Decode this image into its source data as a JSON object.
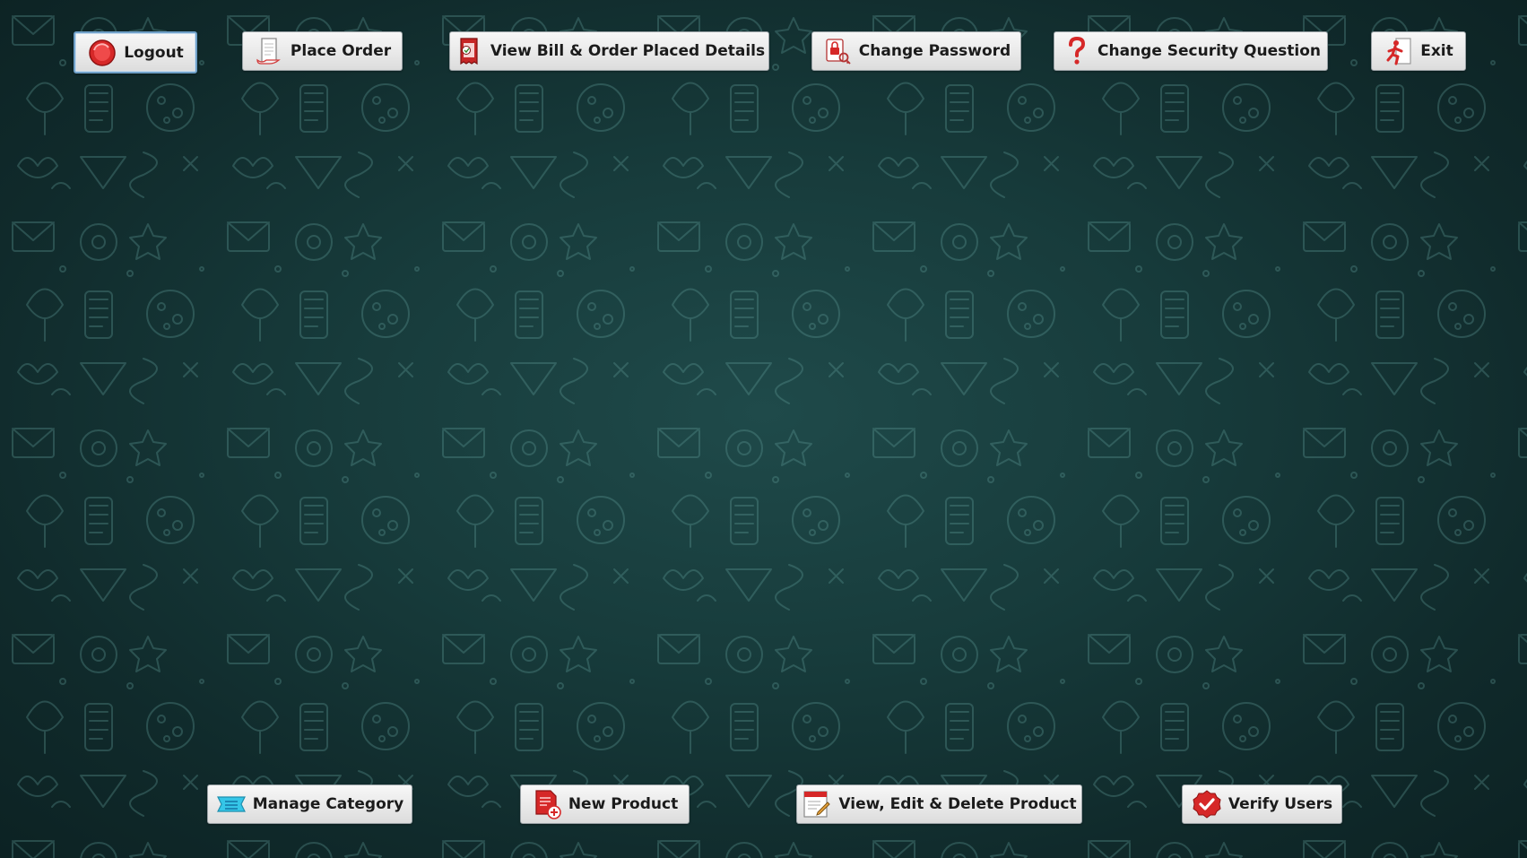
{
  "top_bar": {
    "logout_label": "Logout",
    "place_order_label": "Place Order",
    "view_bill_label": "View Bill & Order Placed Details",
    "change_password_label": "Change Password",
    "change_security_label": "Change Security Question",
    "exit_label": "Exit"
  },
  "bottom_bar": {
    "manage_category_label": "Manage Category",
    "new_product_label": "New Product",
    "view_edit_delete_label": "View, Edit & Delete Product",
    "verify_users_label": "Verify Users"
  },
  "icons": {
    "logout": "power-off-icon",
    "place_order": "order-scroll-icon",
    "view_bill": "receipt-icon",
    "change_password": "password-lock-icon",
    "change_security": "question-mark-icon",
    "exit": "exit-runner-icon",
    "manage_category": "category-icon",
    "new_product": "new-document-icon",
    "view_edit_delete": "edit-document-icon",
    "verify_users": "verified-check-icon"
  },
  "colors": {
    "background": "#173b3b",
    "doodle": "#3f7775",
    "button_face": "#e9e9e9",
    "button_text": "#1b1b1b",
    "icon_red": "#d62828",
    "icon_cyan": "#35c6e8"
  }
}
